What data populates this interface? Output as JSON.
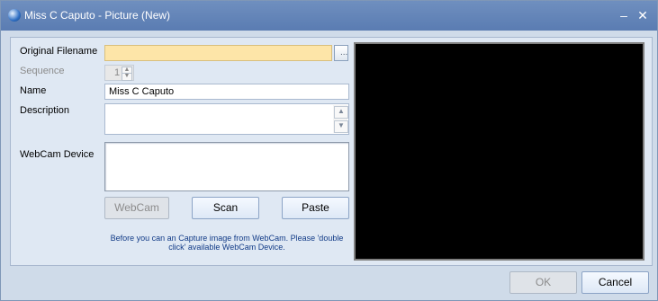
{
  "window": {
    "title": "Miss C Caputo - Picture (New)"
  },
  "form": {
    "original_filename_label": "Original Filename",
    "original_filename_value": "",
    "sequence_label": "Sequence",
    "sequence_value": "1",
    "name_label": "Name",
    "name_value": "Miss C Caputo",
    "description_label": "Description",
    "description_value": "",
    "webcam_device_label": "WebCam Device",
    "browse_label": "...",
    "buttons": {
      "webcam": "WebCam",
      "scan": "Scan",
      "paste": "Paste"
    },
    "note": "Before you can an Capture image from WebCam. Please 'double click' available WebCam Device."
  },
  "footer": {
    "ok": "OK",
    "cancel": "Cancel"
  },
  "icons": {
    "app": "globe-icon",
    "minimize": "minimize-icon",
    "close": "close-icon"
  }
}
